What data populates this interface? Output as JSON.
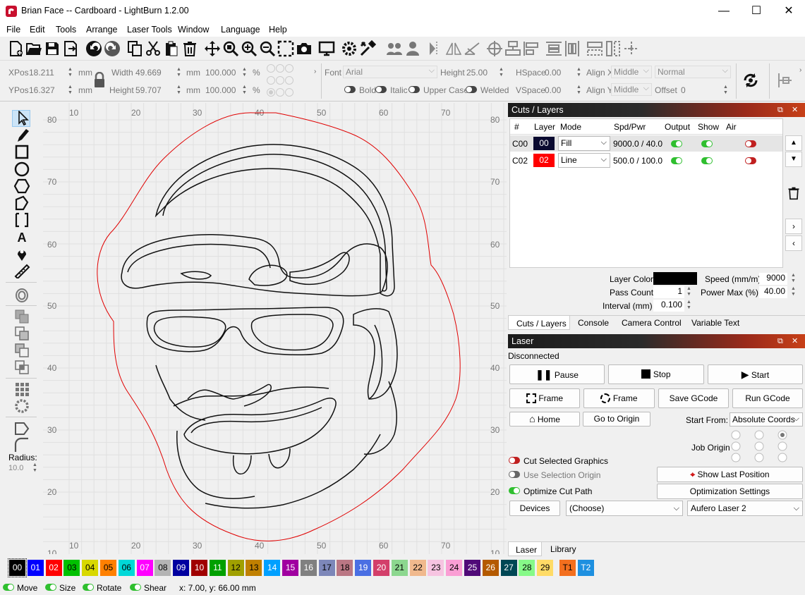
{
  "window": {
    "title": "Brian Face -- Cardboard - LightBurn 1.2.00",
    "min": "—",
    "max": "☐",
    "close": "✕"
  },
  "menu": [
    "File",
    "Edit",
    "Tools",
    "Arrange",
    "Laser Tools",
    "Window",
    "Language",
    "Help"
  ],
  "position": {
    "xpos_label": "XPos",
    "xpos_value": "18.211",
    "ypos_label": "YPos",
    "ypos_value": "16.327",
    "unit": "mm",
    "width_label": "Width",
    "width_value": "49.669",
    "height_label": "Height",
    "height_value": "59.707",
    "scale_w": "100.000",
    "scale_h": "100.000",
    "percent": "%"
  },
  "text_props": {
    "font_label": "Font",
    "font_value": "Arial",
    "height_label": "Height",
    "height_value": "25.00",
    "hspace_label": "HSpace",
    "hspace_value": "0.00",
    "vspace_label": "VSpace",
    "vspace_value": "0.00",
    "alignx_label": "Align X",
    "alignx_value": "Middle",
    "aligny_label": "Align Y",
    "aligny_value": "Middle",
    "style_value": "Normal",
    "offset_label": "Offset",
    "offset_value": "0",
    "bold": "Bold",
    "italic": "Italic",
    "upper": "Upper Case",
    "welded": "Welded"
  },
  "ruler": {
    "x_ticks": [
      "10",
      "20",
      "30",
      "40",
      "50",
      "60",
      "70"
    ],
    "y_ticks": [
      "80",
      "70",
      "60",
      "50",
      "40",
      "30",
      "20",
      "10"
    ]
  },
  "cuts_panel": {
    "title": "Cuts / Layers",
    "headers": [
      "#",
      "Layer",
      "Mode",
      "Spd/Pwr",
      "Output",
      "Show",
      "Air"
    ],
    "rows": [
      {
        "id": "C00",
        "layer": "00",
        "color": "#0a0a30",
        "mode": "Fill",
        "spdpwr": "9000.0 / 40.0"
      },
      {
        "id": "C02",
        "layer": "02",
        "color": "#ff0000",
        "mode": "Line",
        "spdpwr": "500.0 / 100.0"
      }
    ],
    "layer_color_label": "Layer Color",
    "speed_label": "Speed (mm/m)",
    "speed_value": "9000",
    "pass_label": "Pass Count",
    "pass_value": "1",
    "powermax_label": "Power Max (%)",
    "powermax_value": "40.00",
    "interval_label": "Interval (mm)",
    "interval_value": "0.100",
    "tabs": [
      "Cuts / Layers",
      "Console",
      "Camera Control",
      "Variable Text"
    ]
  },
  "laser_panel": {
    "title": "Laser",
    "status": "Disconnected",
    "pause": "Pause",
    "stop": "Stop",
    "start": "Start",
    "frame1": "Frame",
    "frame2": "Frame",
    "save_gcode": "Save GCode",
    "run_gcode": "Run GCode",
    "home": "Home",
    "go_origin": "Go to Origin",
    "start_from_label": "Start From:",
    "start_from_value": "Absolute Coords",
    "job_origin_label": "Job Origin",
    "cut_selected": "Cut Selected Graphics",
    "use_selection": "Use Selection Origin",
    "optimize": "Optimize Cut Path",
    "show_last": "Show Last Position",
    "opt_settings": "Optimization Settings",
    "devices": "Devices",
    "choose": "(Choose)",
    "device": "Aufero Laser 2",
    "tabs": [
      "Laser",
      "Library"
    ]
  },
  "palette": {
    "swatches": [
      {
        "label": "00",
        "color": "#000000",
        "fg": "#ffffff"
      },
      {
        "label": "01",
        "color": "#0000ff",
        "fg": "#ffffff"
      },
      {
        "label": "02",
        "color": "#ff0000",
        "fg": "#ffffff"
      },
      {
        "label": "03",
        "color": "#00c000",
        "fg": "#000000"
      },
      {
        "label": "04",
        "color": "#d8d800",
        "fg": "#000000"
      },
      {
        "label": "05",
        "color": "#ff8000",
        "fg": "#000000"
      },
      {
        "label": "06",
        "color": "#00d8d8",
        "fg": "#000000"
      },
      {
        "label": "07",
        "color": "#ff00ff",
        "fg": "#ffffff"
      },
      {
        "label": "08",
        "color": "#b4b4b4",
        "fg": "#000000"
      },
      {
        "label": "09",
        "color": "#0000a0",
        "fg": "#ffffff"
      },
      {
        "label": "10",
        "color": "#a00000",
        "fg": "#ffffff"
      },
      {
        "label": "11",
        "color": "#00a000",
        "fg": "#ffffff"
      },
      {
        "label": "12",
        "color": "#a0a000",
        "fg": "#000000"
      },
      {
        "label": "13",
        "color": "#c08000",
        "fg": "#000000"
      },
      {
        "label": "14",
        "color": "#00a0ff",
        "fg": "#ffffff"
      },
      {
        "label": "15",
        "color": "#a000a0",
        "fg": "#ffffff"
      },
      {
        "label": "16",
        "color": "#808080",
        "fg": "#ffffff"
      },
      {
        "label": "17",
        "color": "#7d87b9",
        "fg": "#000000"
      },
      {
        "label": "18",
        "color": "#bb7784",
        "fg": "#000000"
      },
      {
        "label": "19",
        "color": "#4a6fe3",
        "fg": "#ffffff"
      },
      {
        "label": "20",
        "color": "#d33f6a",
        "fg": "#ffffff"
      },
      {
        "label": "21",
        "color": "#8cd78f",
        "fg": "#000000"
      },
      {
        "label": "22",
        "color": "#f0b98d",
        "fg": "#000000"
      },
      {
        "label": "23",
        "color": "#f6c4e1",
        "fg": "#000000"
      },
      {
        "label": "24",
        "color": "#fa9ed4",
        "fg": "#000000"
      },
      {
        "label": "25",
        "color": "#500a78",
        "fg": "#ffffff"
      },
      {
        "label": "26",
        "color": "#b45a00",
        "fg": "#ffffff"
      },
      {
        "label": "27",
        "color": "#004754",
        "fg": "#ffffff"
      },
      {
        "label": "28",
        "color": "#86fa88",
        "fg": "#000000"
      },
      {
        "label": "29",
        "color": "#ffdb66",
        "fg": "#000000"
      },
      {
        "label": "T1",
        "color": "#f36f1e",
        "fg": "#000000"
      },
      {
        "label": "T2",
        "color": "#1e90e0",
        "fg": "#ffffff"
      }
    ]
  },
  "tools": {
    "radius_label": "Radius:",
    "radius_value": "10.0"
  },
  "status": {
    "move": "Move",
    "size": "Size",
    "rotate": "Rotate",
    "shear": "Shear",
    "coords": "x: 7.00, y: 66.00 mm"
  }
}
